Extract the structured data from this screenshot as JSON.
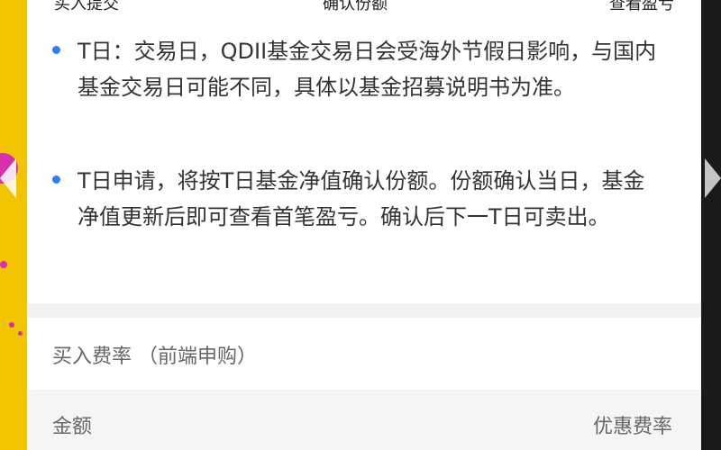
{
  "steps": {
    "left": "买入提交",
    "middle": "确认份额",
    "right": "查看盈亏"
  },
  "notes": [
    {
      "text": "T日：交易日，QDII基金交易日会受海外节假日影响，与国内基金交易日可能不同，具体以基金招募说明书为准。"
    },
    {
      "text": "T日申请，将按T日基金净值确认份额。份额确认当日，基金净值更新后即可查看首笔盈亏。确认后下一T日可卖出。"
    }
  ],
  "rate_section": {
    "title": "买入费率 （前端申购）",
    "columns": [
      "金额",
      "优惠费率"
    ]
  },
  "colors": {
    "bullet": "#2f7cf6",
    "backdrop": "#f3c400",
    "section_gap": "#f2f2f2"
  }
}
